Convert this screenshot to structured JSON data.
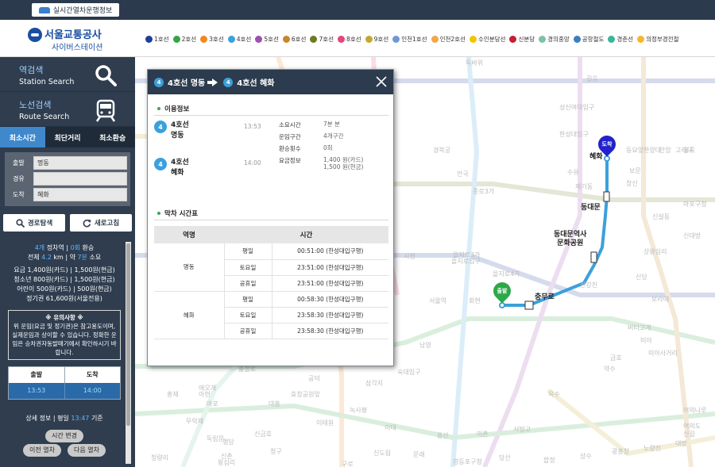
{
  "topbar": {
    "realtime_label": "실시간열차운행정보"
  },
  "header": {
    "logo_title": "서울교통공사",
    "logo_sub": "사이버스테이션",
    "legend": [
      {
        "label": "1호선",
        "color": "#1c3f9a"
      },
      {
        "label": "2호선",
        "color": "#36a548"
      },
      {
        "label": "3호선",
        "color": "#ef8a1f"
      },
      {
        "label": "4호선",
        "color": "#3ba0dc"
      },
      {
        "label": "5호선",
        "color": "#9b4fb0"
      },
      {
        "label": "6호선",
        "color": "#c8862a"
      },
      {
        "label": "7호선",
        "color": "#6c7a22"
      },
      {
        "label": "8호선",
        "color": "#e6457a"
      },
      {
        "label": "9호선",
        "color": "#c4a82c"
      },
      {
        "label": "인천1호선",
        "color": "#6f97d8"
      },
      {
        "label": "인천2호선",
        "color": "#f4a54a"
      },
      {
        "label": "수인분당선",
        "color": "#f2c500"
      },
      {
        "label": "신분당",
        "color": "#c51f32"
      },
      {
        "label": "경의중앙",
        "color": "#7cc4a5"
      },
      {
        "label": "공항철도",
        "color": "#3a7fbf"
      },
      {
        "label": "경춘선",
        "color": "#3ab59a"
      },
      {
        "label": "의정부경전철",
        "color": "#f6b62e"
      }
    ]
  },
  "sidebar": {
    "station_search": {
      "title": "역검색",
      "sub": "Station Search"
    },
    "route_search": {
      "title": "노선검색",
      "sub": "Route Search"
    },
    "tabs": [
      "최소시간",
      "최단거리",
      "최소환승"
    ],
    "form": {
      "depart_label": "출발",
      "depart_value": "명동",
      "via_label": "경유",
      "via_value": "",
      "arrive_label": "도착",
      "arrive_value": "혜화"
    },
    "route_search_btn": "경로탐색",
    "refresh_btn": "새로고침",
    "summary": {
      "stations": "4개",
      "line1_mid": " 정차역 | ",
      "transfers": "0회",
      "line1_end": " 환승",
      "total_pre": "전체 ",
      "distance": "4.2",
      "total_mid": " km | 약 ",
      "duration": "7분",
      "total_end": " 소요",
      "fare_adult": "요금 1,400원(카드) | 1,500원(현금)",
      "fare_youth": "청소년 800원(카드) | 1,500원(현금)",
      "fare_child": "어린이 500원(카드) | 500원(현금)",
      "fare_pass": "정기권 61,600원(서울전용)"
    },
    "notice_title": "※ 유의사항 ※",
    "notice_text": "위 운임(요금 및 정기권)은 참고용도이며, 실제운임과 상이할 수 있습니다. 정확한 운임은 승차권자동발매기에서 확인하시기 바랍니다.",
    "dep_label": "출발",
    "arr_label": "도착",
    "dep_time": "13:53",
    "arr_time": "14:00",
    "detail_pre": "상세 정보 | 평일 ",
    "detail_time": "13:47",
    "detail_post": " 기준",
    "time_change_btn": "시간 변경",
    "prev_train_btn": "이전 열차",
    "next_train_btn": "다음 열차"
  },
  "map": {
    "stations": {
      "hyehwa": "혜화",
      "dongdaemun": "동대문",
      "ddp_1": "동대문역사",
      "ddp_2": "문화공원",
      "chungmuro": "충무로"
    },
    "depart_pin": "출발",
    "arrive_pin": "도착",
    "faint_labels": [
      "독바위",
      "길음",
      "성신여대입구",
      "한성대입구",
      "경복궁",
      "안국",
      "종로3가",
      "을지로입구",
      "을지로3가",
      "을지로4가",
      "서울역",
      "회현",
      "남영",
      "숙대입구",
      "삼각지",
      "녹사평",
      "이태원",
      "한강진",
      "약수",
      "버티고개",
      "신당",
      "상왕십리",
      "보문",
      "창신",
      "신설동",
      "광화문",
      "시청",
      "공덕",
      "효창공원앞",
      "대흥",
      "마포",
      "애오개",
      "충정로",
      "서대문",
      "아현",
      "홍제",
      "무악재",
      "독립문",
      "신촌",
      "이대",
      "용산",
      "이촌",
      "서빙고",
      "옥수",
      "금호",
      "동묘앞",
      "한양대",
      "안암",
      "고려대",
      "월곡",
      "미아",
      "미아사거리",
      "수유",
      "제기동",
      "청량리",
      "왕십리",
      "행당",
      "신금호",
      "청구",
      "구로",
      "신도림",
      "문래",
      "영등포구청",
      "당산",
      "합정",
      "상수",
      "광흥창",
      "노량진",
      "대방",
      "신길",
      "여의도",
      "여의나루",
      "마포구청",
      "신대방",
      "보라매"
    ]
  },
  "modal": {
    "title_from": "4호선 명동",
    "title_to": "4호선 혜화",
    "usage_title": "이용정보",
    "from_line": "4호선",
    "from_station": "명동",
    "from_time": "13:53",
    "to_line": "4호선",
    "to_station": "혜화",
    "to_time": "14:00",
    "line_badge": "4",
    "info": {
      "time_k": "소요시간",
      "time_v": "7분 분",
      "section_k": "운임구간",
      "section_v": "4개구간",
      "transfer_k": "환승횟수",
      "transfer_v": "0회",
      "fare_k": "요금정보",
      "fare_card": "1,400 원(카드)",
      "fare_cash": "1,500 원(현금)"
    },
    "last_title": "막차 시간표",
    "table_headers": [
      "역명",
      "시간"
    ],
    "table": [
      {
        "station": "명동",
        "rows": [
          {
            "day": "평일",
            "time": "00:51:00 (한성대입구행)"
          },
          {
            "day": "토요일",
            "time": "23:51:00 (한성대입구행)"
          },
          {
            "day": "공휴일",
            "time": "23:51:00 (한성대입구행)"
          }
        ]
      },
      {
        "station": "혜화",
        "rows": [
          {
            "day": "평일",
            "time": "00:58:30 (한성대입구행)"
          },
          {
            "day": "토요일",
            "time": "23:58:30 (한성대입구행)"
          },
          {
            "day": "공휴일",
            "time": "23:58:30 (한성대입구행)"
          }
        ]
      }
    ]
  }
}
